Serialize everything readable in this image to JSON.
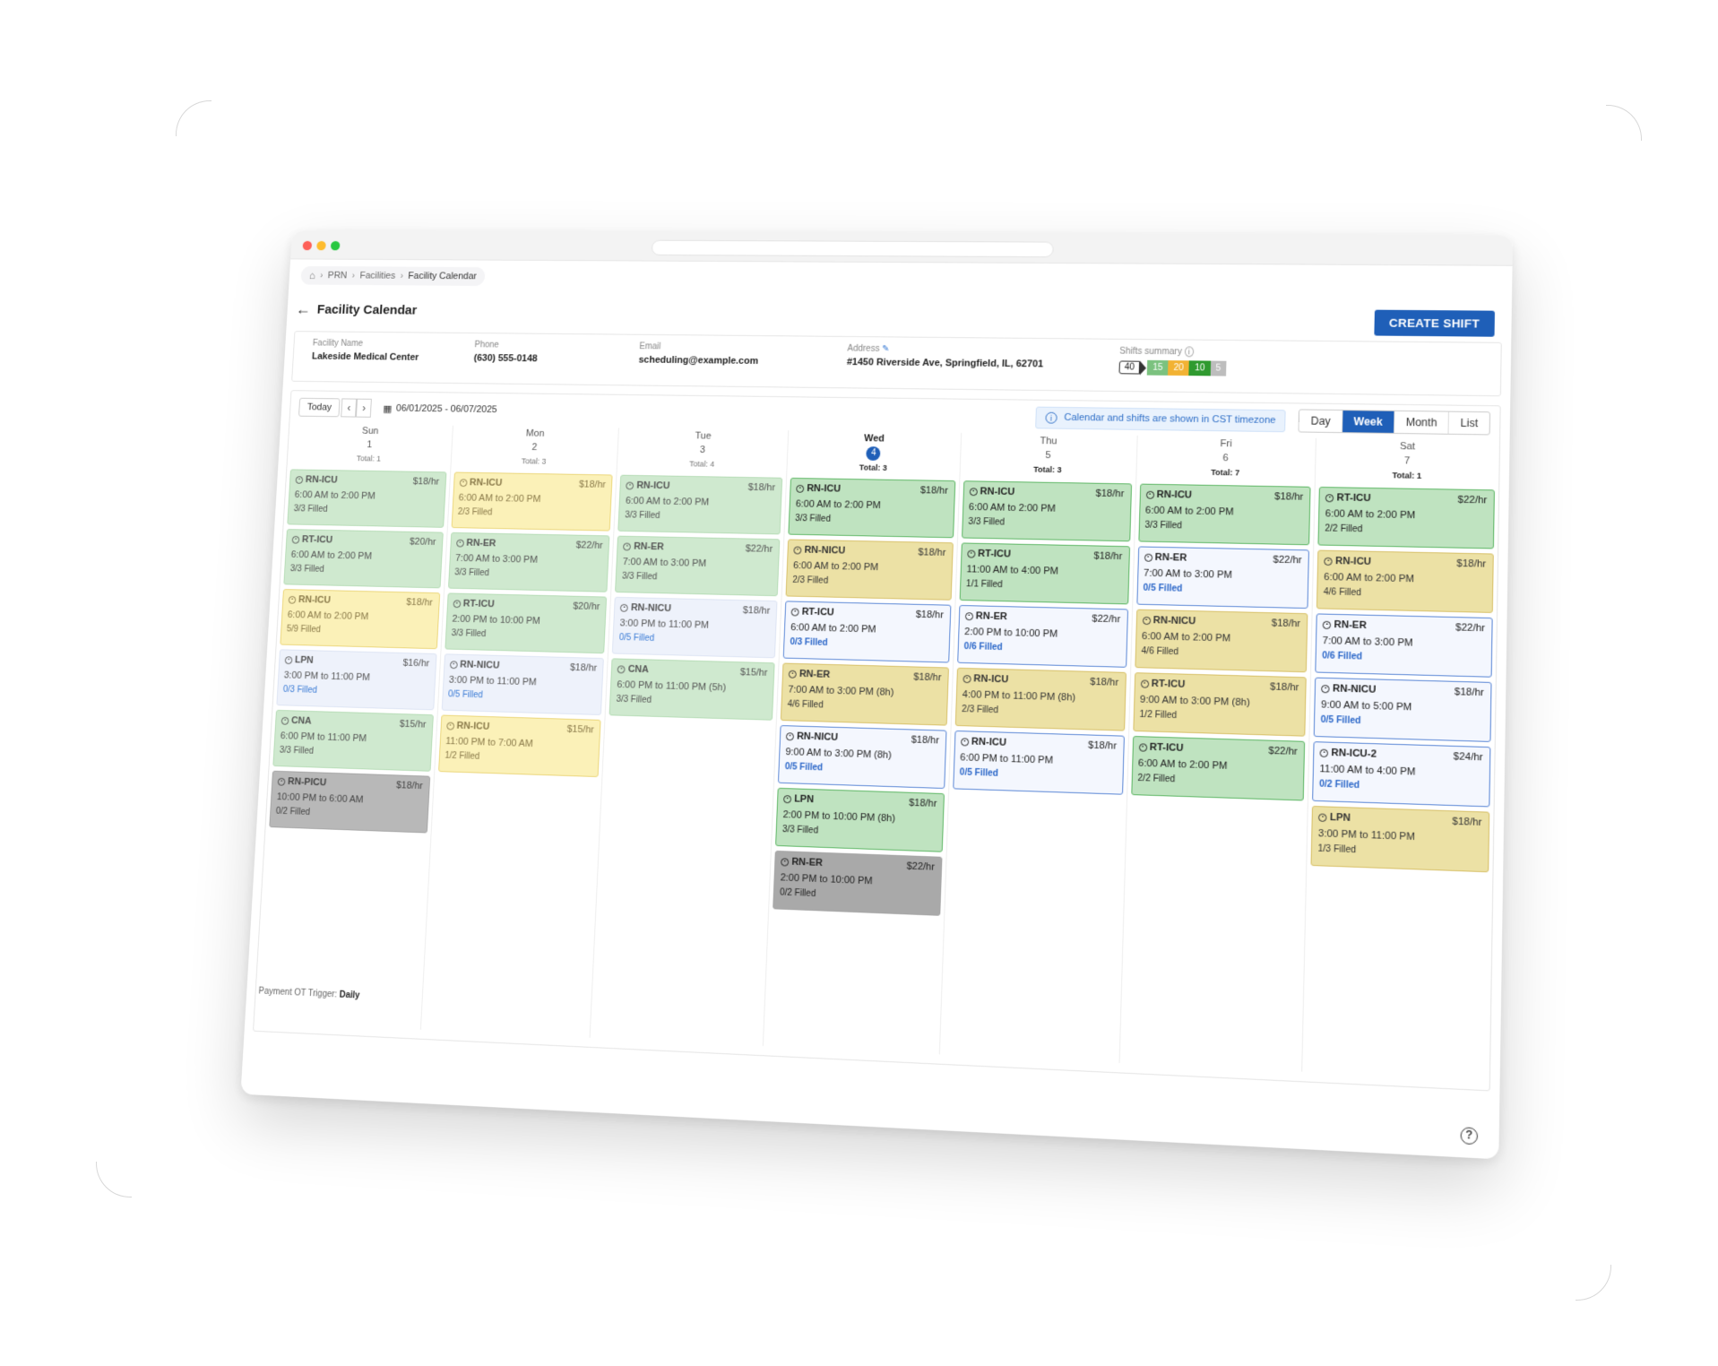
{
  "breadcrumb": {
    "items": [
      "PRN",
      "Facilities",
      "Facility Calendar"
    ]
  },
  "page": {
    "title": "Facility Calendar",
    "create_label": "CREATE SHIFT"
  },
  "facility": {
    "name_label": "Facility Name",
    "name": "Lakeside Medical Center",
    "phone_label": "Phone",
    "phone": "(630) 555-0148",
    "email_label": "Email",
    "email": "scheduling@example.com",
    "address_label": "Address",
    "address": "#1450 Riverside Ave, Springfield, IL, 62701",
    "summary_label": "Shifts summary",
    "summary": {
      "total": "40",
      "green": "15",
      "orange": "20",
      "darkgreen": "10",
      "gray": "5"
    }
  },
  "colors": {
    "accent": "#1f5fb8",
    "sum_green": "#7bc27f",
    "sum_orange": "#f2b233",
    "sum_darkgreen": "#2f9a2f",
    "sum_gray": "#bdbdbd"
  },
  "toolbar": {
    "today": "Today",
    "prev": "‹",
    "next": "›",
    "date_range": "06/01/2025 - 06/07/2025",
    "tz_text": "Calendar and shifts are shown in CST timezone",
    "views": [
      "Day",
      "Week",
      "Month",
      "List"
    ],
    "active_view": "Week"
  },
  "days": [
    {
      "name": "Sun",
      "num": "1",
      "total": "Total: 1",
      "shifts": [
        {
          "role": "RN-ICU",
          "rate": "$18/hr",
          "time": "6:00 AM to 2:00 PM",
          "fill": "3/3 Filled",
          "status": "green"
        },
        {
          "role": "RT-ICU",
          "rate": "$20/hr",
          "time": "6:00 AM to 2:00 PM",
          "fill": "3/3 Filled",
          "status": "green"
        },
        {
          "role": "RN-ICU",
          "rate": "$18/hr",
          "time": "6:00 AM to 2:00 PM",
          "fill": "5/9 Filled",
          "status": "yellow"
        },
        {
          "role": "LPN",
          "rate": "$16/hr",
          "time": "3:00 PM to 11:00 PM",
          "fill": "0/3 Filled",
          "status": "blue"
        },
        {
          "role": "CNA",
          "rate": "$15/hr",
          "time": "6:00 PM to 11:00 PM",
          "fill": "3/3 Filled",
          "status": "green"
        },
        {
          "role": "RN-PICU",
          "rate": "$18/hr",
          "time": "10:00 PM to 6:00 AM",
          "fill": "0/2 Filled",
          "status": "gray"
        }
      ]
    },
    {
      "name": "Mon",
      "num": "2",
      "total": "Total: 3",
      "shifts": [
        {
          "role": "RN-ICU",
          "rate": "$18/hr",
          "time": "6:00 AM to 2:00 PM",
          "fill": "2/3 Filled",
          "status": "yellow"
        },
        {
          "role": "RN-ER",
          "rate": "$22/hr",
          "time": "7:00 AM to 3:00 PM",
          "fill": "3/3 Filled",
          "status": "green"
        },
        {
          "role": "RT-ICU",
          "rate": "$20/hr",
          "time": "2:00 PM to 10:00 PM",
          "fill": "3/3 Filled",
          "status": "green"
        },
        {
          "role": "RN-NICU",
          "rate": "$18/hr",
          "time": "3:00 PM to 11:00 PM",
          "fill": "0/5 Filled",
          "status": "blue"
        },
        {
          "role": "RN-ICU",
          "rate": "$15/hr",
          "time": "11:00 PM to 7:00 AM",
          "fill": "1/2 Filled",
          "status": "yellow"
        }
      ]
    },
    {
      "name": "Tue",
      "num": "3",
      "total": "Total: 4",
      "shifts": [
        {
          "role": "RN-ICU",
          "rate": "$18/hr",
          "time": "6:00 AM to 2:00 PM",
          "fill": "3/3 Filled",
          "status": "green"
        },
        {
          "role": "RN-ER",
          "rate": "$22/hr",
          "time": "7:00 AM to 3:00 PM",
          "fill": "3/3 Filled",
          "status": "green"
        },
        {
          "role": "RN-NICU",
          "rate": "$18/hr",
          "time": "3:00 PM to 11:00 PM",
          "fill": "0/5 Filled",
          "status": "blue"
        },
        {
          "role": "CNA",
          "rate": "$15/hr",
          "time": "6:00 PM to 11:00 PM (5h)",
          "fill": "3/3 Filled",
          "status": "green"
        }
      ]
    },
    {
      "name": "Wed",
      "num": "4",
      "total": "Total: 3",
      "today": true,
      "shifts": [
        {
          "role": "RN-ICU",
          "rate": "$18/hr",
          "time": "6:00 AM to 2:00 PM",
          "fill": "3/3 Filled",
          "status": "green"
        },
        {
          "role": "RN-NICU",
          "rate": "$18/hr",
          "time": "6:00 AM to 2:00 PM",
          "fill": "2/3 Filled",
          "status": "yellow"
        },
        {
          "role": "RT-ICU",
          "rate": "$18/hr",
          "time": "6:00 AM to 2:00 PM",
          "fill": "0/3 Filled",
          "status": "blue"
        },
        {
          "role": "RN-ER",
          "rate": "$18/hr",
          "time": "7:00 AM to 3:00 PM (8h)",
          "fill": "4/6 Filled",
          "status": "yellow"
        },
        {
          "role": "RN-NICU",
          "rate": "$18/hr",
          "time": "9:00 AM to 3:00 PM (8h)",
          "fill": "0/5 Filled",
          "status": "blue"
        },
        {
          "role": "LPN",
          "rate": "$18/hr",
          "time": "2:00 PM to 10:00 PM (8h)",
          "fill": "3/3 Filled",
          "status": "green"
        },
        {
          "role": "RN-ER",
          "rate": "$22/hr",
          "time": "2:00 PM to 10:00 PM",
          "fill": "0/2 Filled",
          "status": "gray"
        }
      ]
    },
    {
      "name": "Thu",
      "num": "5",
      "total": "Total: 3",
      "shifts": [
        {
          "role": "RN-ICU",
          "rate": "$18/hr",
          "time": "6:00 AM to 2:00 PM",
          "fill": "3/3 Filled",
          "status": "green"
        },
        {
          "role": "RT-ICU",
          "rate": "$18/hr",
          "time": "11:00 AM to 4:00 PM",
          "fill": "1/1 Filled",
          "status": "green"
        },
        {
          "role": "RN-ER",
          "rate": "$22/hr",
          "time": "2:00 PM to 10:00 PM",
          "fill": "0/6 Filled",
          "status": "blue"
        },
        {
          "role": "RN-ICU",
          "rate": "$18/hr",
          "time": "4:00 PM to 11:00 PM (8h)",
          "fill": "2/3 Filled",
          "status": "yellow"
        },
        {
          "role": "RN-ICU",
          "rate": "$18/hr",
          "time": "6:00 PM to 11:00 PM",
          "fill": "0/5 Filled",
          "status": "blue"
        }
      ]
    },
    {
      "name": "Fri",
      "num": "6",
      "total": "Total: 7",
      "shifts": [
        {
          "role": "RN-ICU",
          "rate": "$18/hr",
          "time": "6:00 AM to 2:00 PM",
          "fill": "3/3 Filled",
          "status": "green"
        },
        {
          "role": "RN-ER",
          "rate": "$22/hr",
          "time": "7:00 AM to 3:00 PM",
          "fill": "0/5 Filled",
          "status": "blue"
        },
        {
          "role": "RN-NICU",
          "rate": "$18/hr",
          "time": "6:00 AM to 2:00 PM",
          "fill": "4/6 Filled",
          "status": "yellow"
        },
        {
          "role": "RT-ICU",
          "rate": "$18/hr",
          "time": "9:00 AM to 3:00 PM (8h)",
          "fill": "1/2 Filled",
          "status": "yellow"
        },
        {
          "role": "RT-ICU",
          "rate": "$22/hr",
          "time": "6:00 AM to 2:00 PM",
          "fill": "2/2 Filled",
          "status": "green"
        }
      ]
    },
    {
      "name": "Sat",
      "num": "7",
      "total": "Total: 1",
      "shifts": [
        {
          "role": "RT-ICU",
          "rate": "$22/hr",
          "time": "6:00 AM to 2:00 PM",
          "fill": "2/2 Filled",
          "status": "green"
        },
        {
          "role": "RN-ICU",
          "rate": "$18/hr",
          "time": "6:00 AM to 2:00 PM",
          "fill": "4/6 Filled",
          "status": "yellow"
        },
        {
          "role": "RN-ER",
          "rate": "$22/hr",
          "time": "7:00 AM to 3:00 PM",
          "fill": "0/6 Filled",
          "status": "blue"
        },
        {
          "role": "RN-NICU",
          "rate": "$18/hr",
          "time": "9:00 AM to 5:00 PM",
          "fill": "0/5 Filled",
          "status": "blue"
        },
        {
          "role": "RN-ICU-2",
          "rate": "$24/hr",
          "time": "11:00 AM to 4:00 PM",
          "fill": "0/2 Filled",
          "status": "blue"
        },
        {
          "role": "LPN",
          "rate": "$18/hr",
          "time": "3:00 PM to 11:00 PM",
          "fill": "1/3 Filled",
          "status": "yellow"
        }
      ]
    }
  ],
  "footer": {
    "ot_label": "Payment OT Trigger:",
    "ot_value": "Daily",
    "help": "?"
  }
}
